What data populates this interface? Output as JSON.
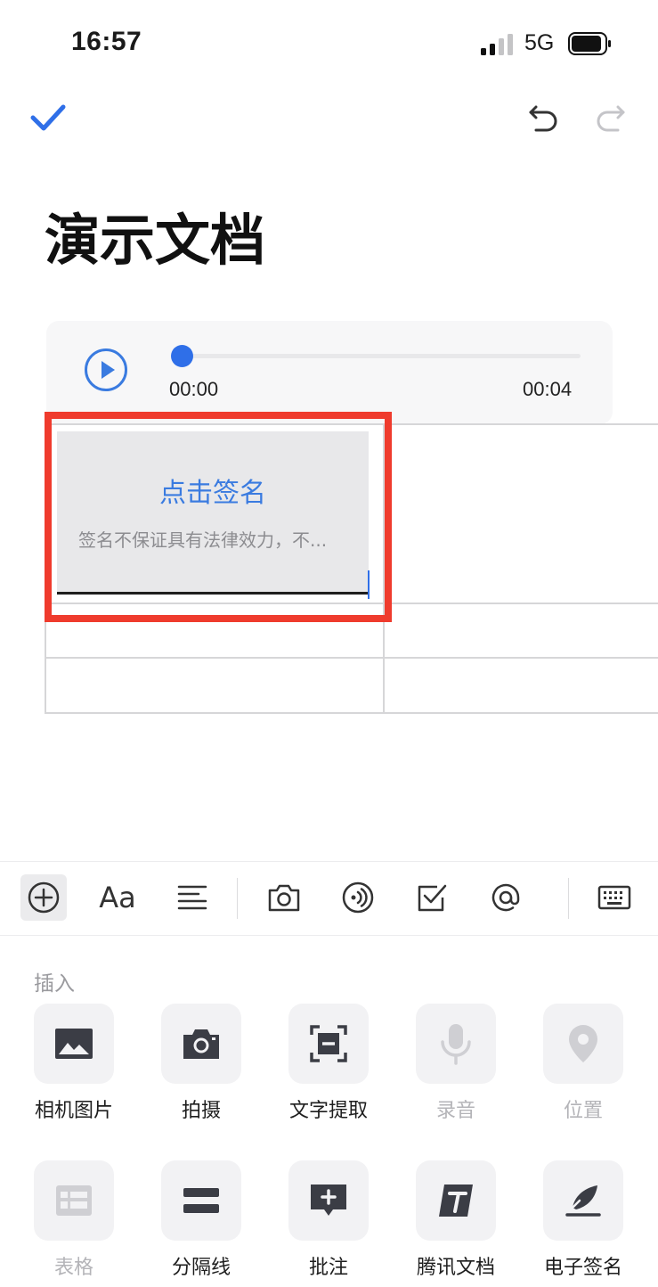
{
  "status_bar": {
    "time": "16:57",
    "network": "5G"
  },
  "document": {
    "title": "演示文档"
  },
  "audio": {
    "current_time": "00:00",
    "total_time": "00:04",
    "progress": 0.0
  },
  "signature": {
    "cta": "点击签名",
    "hint": "签名不保证具有法律效力，不..."
  },
  "colors": {
    "accent": "#2f6fe8",
    "highlight": "#ef3b2d"
  },
  "toolbar": {
    "items": [
      {
        "name": "insert",
        "icon": "plus-circle-icon",
        "active": true
      },
      {
        "name": "text-style",
        "icon": "font-aa-icon",
        "label": "Aa"
      },
      {
        "name": "paragraph",
        "icon": "align-left-icon"
      },
      {
        "name": "camera",
        "icon": "camera-icon"
      },
      {
        "name": "audio",
        "icon": "audio-wave-icon"
      },
      {
        "name": "checklist",
        "icon": "checkbox-icon"
      },
      {
        "name": "mention",
        "icon": "at-icon"
      },
      {
        "name": "keyboard",
        "icon": "keyboard-icon"
      }
    ]
  },
  "insert_panel": {
    "title": "插入",
    "items": [
      {
        "label": "相机图片",
        "icon": "image-icon",
        "enabled": true
      },
      {
        "label": "拍摄",
        "icon": "camera-icon",
        "enabled": true
      },
      {
        "label": "文字提取",
        "icon": "text-scan-icon",
        "enabled": true
      },
      {
        "label": "录音",
        "icon": "microphone-icon",
        "enabled": false
      },
      {
        "label": "位置",
        "icon": "location-pin-icon",
        "enabled": false
      },
      {
        "label": "表格",
        "icon": "table-icon",
        "enabled": false
      },
      {
        "label": "分隔线",
        "icon": "divider-icon",
        "enabled": true
      },
      {
        "label": "批注",
        "icon": "comment-add-icon",
        "enabled": true
      },
      {
        "label": "腾讯文档",
        "icon": "tencent-docs-icon",
        "enabled": true
      },
      {
        "label": "电子签名",
        "icon": "signature-pen-icon",
        "enabled": true
      }
    ]
  }
}
